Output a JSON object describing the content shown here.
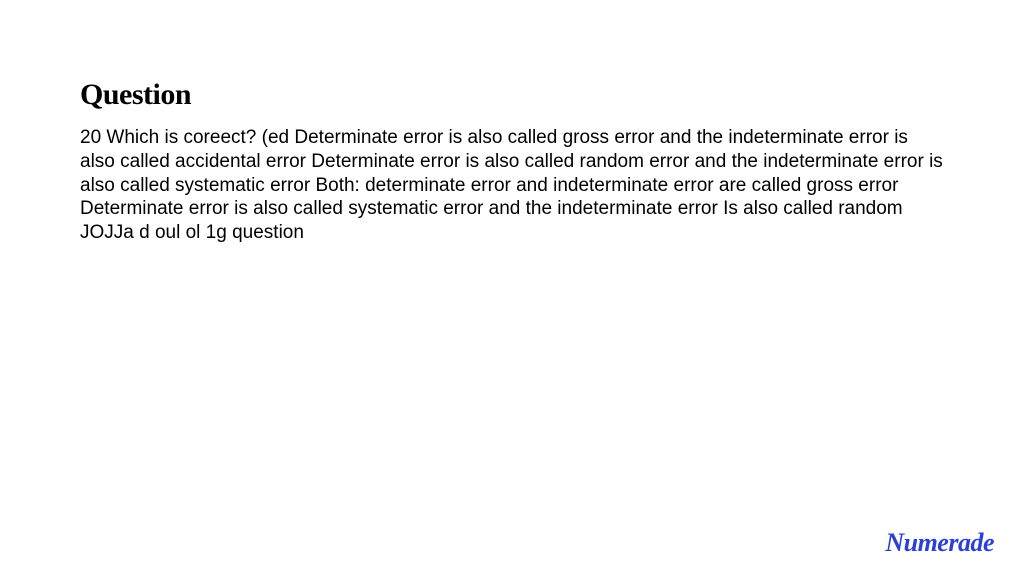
{
  "heading": "Question",
  "body": "20 Which is coreect? (ed Determinate error is also called gross error and the indeterminate error is also called accidental error Determinate error is also called random error and the indeterminate error is also called systematic error Both: determinate error and indeterminate error are called gross error Determinate error is also called systematic error and the indeterminate error Is also called random JOJJa d oul ol 1g question",
  "logo": "Numerade"
}
